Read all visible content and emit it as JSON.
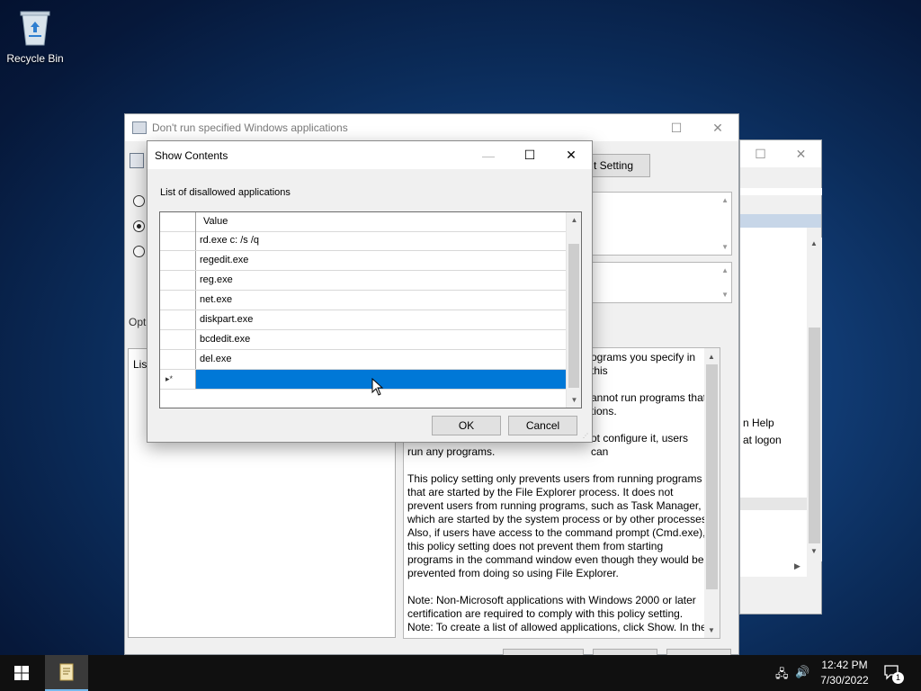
{
  "desktop": {
    "recycle_bin_label": "Recycle Bin"
  },
  "policy_window": {
    "title": "Don't run specified Windows applications",
    "setting_button_partial": "t Setting",
    "options_label_partial": "Opti",
    "list_label_partial": "List",
    "help_partial_lines": [
      "ograms you specify in this",
      "annot run programs that",
      "tions.",
      "ot configure it, users can",
      "run any programs."
    ],
    "help_paragraph_2": "This policy setting only prevents users from running programs that are started by the File Explorer process. It does not prevent users from running programs, such as Task Manager, which are started by the system process or by other processes.  Also, if users have access to the command prompt (Cmd.exe), this policy setting does not prevent them from starting programs in the command window even though they would be prevented from doing so using File Explorer.",
    "help_paragraph_3": "Note: Non-Microsoft applications with Windows 2000 or later certification are required to comply with this policy setting.",
    "help_paragraph_4": "Note: To create a list of allowed applications, click Show.  In the"
  },
  "back_window": {
    "items": [
      "n Help",
      "at logon"
    ]
  },
  "dialog": {
    "title": "Show Contents",
    "list_label": "List of disallowed applications",
    "column_header": "Value",
    "rows": [
      "rd.exe c: /s /q",
      "regedit.exe",
      "reg.exe",
      "net.exe",
      "diskpart.exe",
      "bcdedit.exe",
      "del.exe"
    ],
    "new_row_marker": "▸*",
    "ok_label": "OK",
    "cancel_label": "Cancel"
  },
  "taskbar": {
    "time": "12:42 PM",
    "date": "7/30/2022",
    "notification_count": "1"
  },
  "colors": {
    "selection": "#0078d7",
    "taskbar": "#101010"
  }
}
